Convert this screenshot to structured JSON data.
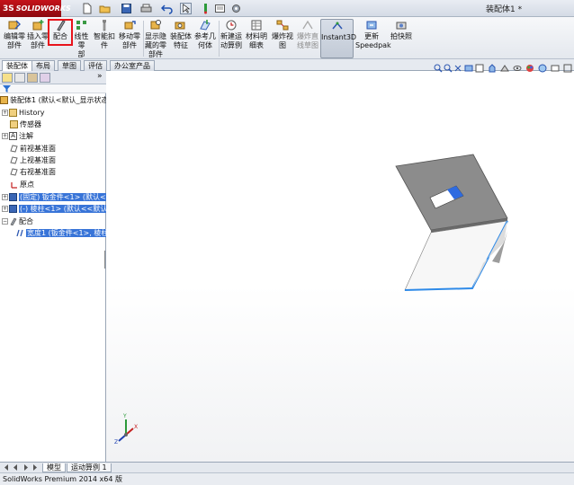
{
  "app": {
    "logo_text": "SOLIDWORKS",
    "logo_prefix": "3S",
    "document_title": "装配体1 *"
  },
  "commands": [
    {
      "label_line1": "编辑零",
      "label_line2": "部件"
    },
    {
      "label_line1": "插入零",
      "label_line2": "部件"
    },
    {
      "label_line1": "配合",
      "label_line2": ""
    },
    {
      "label_line1": "线性零",
      "label_line2": "部件..."
    },
    {
      "label_line1": "智能扣",
      "label_line2": "件"
    },
    {
      "label_line1": "移动零",
      "label_line2": "部件"
    },
    {
      "label_line1": "显示隐",
      "label_line2": "藏的零",
      "label_line3": "部件"
    },
    {
      "label_line1": "装配体",
      "label_line2": "特征"
    },
    {
      "label_line1": "参考几",
      "label_line2": "何体"
    },
    {
      "label_line1": "新建运",
      "label_line2": "动算例"
    },
    {
      "label_line1": "材料明",
      "label_line2": "细表"
    },
    {
      "label_line1": "爆炸视",
      "label_line2": "图"
    },
    {
      "label_line1": "爆炸直",
      "label_line2": "线草图"
    },
    {
      "label_line1": "Instant3D",
      "label_line2": ""
    },
    {
      "label_line1": "更新",
      "label_line2": "Speedpak"
    },
    {
      "label_line1": "拍快照",
      "label_line2": ""
    }
  ],
  "tabs": [
    "装配体",
    "布局",
    "草图",
    "评估",
    "办公室产品"
  ],
  "tree": {
    "root": "装配体1 (默认<默认_显示状态",
    "items": [
      {
        "label": "History"
      },
      {
        "label": "传感器"
      },
      {
        "label": "注解"
      },
      {
        "label": "前视基准面"
      },
      {
        "label": "上视基准面"
      },
      {
        "label": "右视基准面"
      },
      {
        "label": "原点"
      },
      {
        "label": "(固定) 钣金件<1> (默认<<"
      },
      {
        "label": "(-) 棱柱<1> (默认<<默认>"
      },
      {
        "label": "配合"
      },
      {
        "label": "宽度1 (钣金件<1>, 棱柱"
      }
    ]
  },
  "bottom_tabs": [
    "模型",
    "运动算例 1"
  ],
  "status": {
    "text": "SolidWorks Premium 2014 x64 版"
  }
}
